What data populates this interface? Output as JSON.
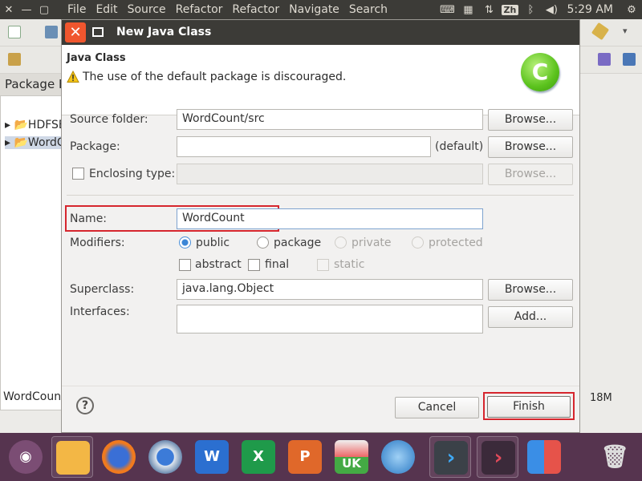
{
  "topbar": {
    "menu": [
      "File",
      "Edit",
      "Source",
      "Refactor",
      "Refactor",
      "Navigate",
      "Search"
    ],
    "ime": "Zh",
    "time": "5:29 AM"
  },
  "eclipse": {
    "view_tab": "Package Explorer",
    "tree": [
      "HDFSExample",
      "WordCount"
    ],
    "status": "WordCount",
    "memory": "18M"
  },
  "dialog": {
    "title": "New Java Class",
    "header_title": "Java Class",
    "header_message": "The use of the default package is discouraged.",
    "logo_letter": "C",
    "source_folder": {
      "label": "Source folder:",
      "value": "WordCount/src",
      "button": "Browse..."
    },
    "package": {
      "label": "Package:",
      "value": "",
      "hint": "(default)",
      "button": "Browse..."
    },
    "enclosing": {
      "label": "Enclosing type:",
      "value": "",
      "button": "Browse..."
    },
    "name": {
      "label": "Name:",
      "value": "WordCount"
    },
    "modifiers": {
      "label": "Modifiers:",
      "access": [
        "public",
        "package",
        "private",
        "protected"
      ],
      "flags": [
        "abstract",
        "final",
        "static"
      ]
    },
    "superclass": {
      "label": "Superclass:",
      "value": "java.lang.Object",
      "button": "Browse..."
    },
    "interfaces": {
      "label": "Interfaces:",
      "button": "Add..."
    },
    "footer": {
      "help": "?",
      "cancel": "Cancel",
      "finish": "Finish"
    }
  },
  "dock": {
    "apps": [
      "ubuntu",
      "files",
      "firefox",
      "chromium",
      "word",
      "excel",
      "powerpoint",
      "ubuntu-store",
      "remote-desktop",
      "vscode",
      "terminal",
      "workspace",
      "trash"
    ],
    "app_text": [
      "",
      "",
      "",
      "",
      "W",
      "X",
      "P",
      "UK",
      "",
      "",
      "",
      "",
      ""
    ]
  }
}
